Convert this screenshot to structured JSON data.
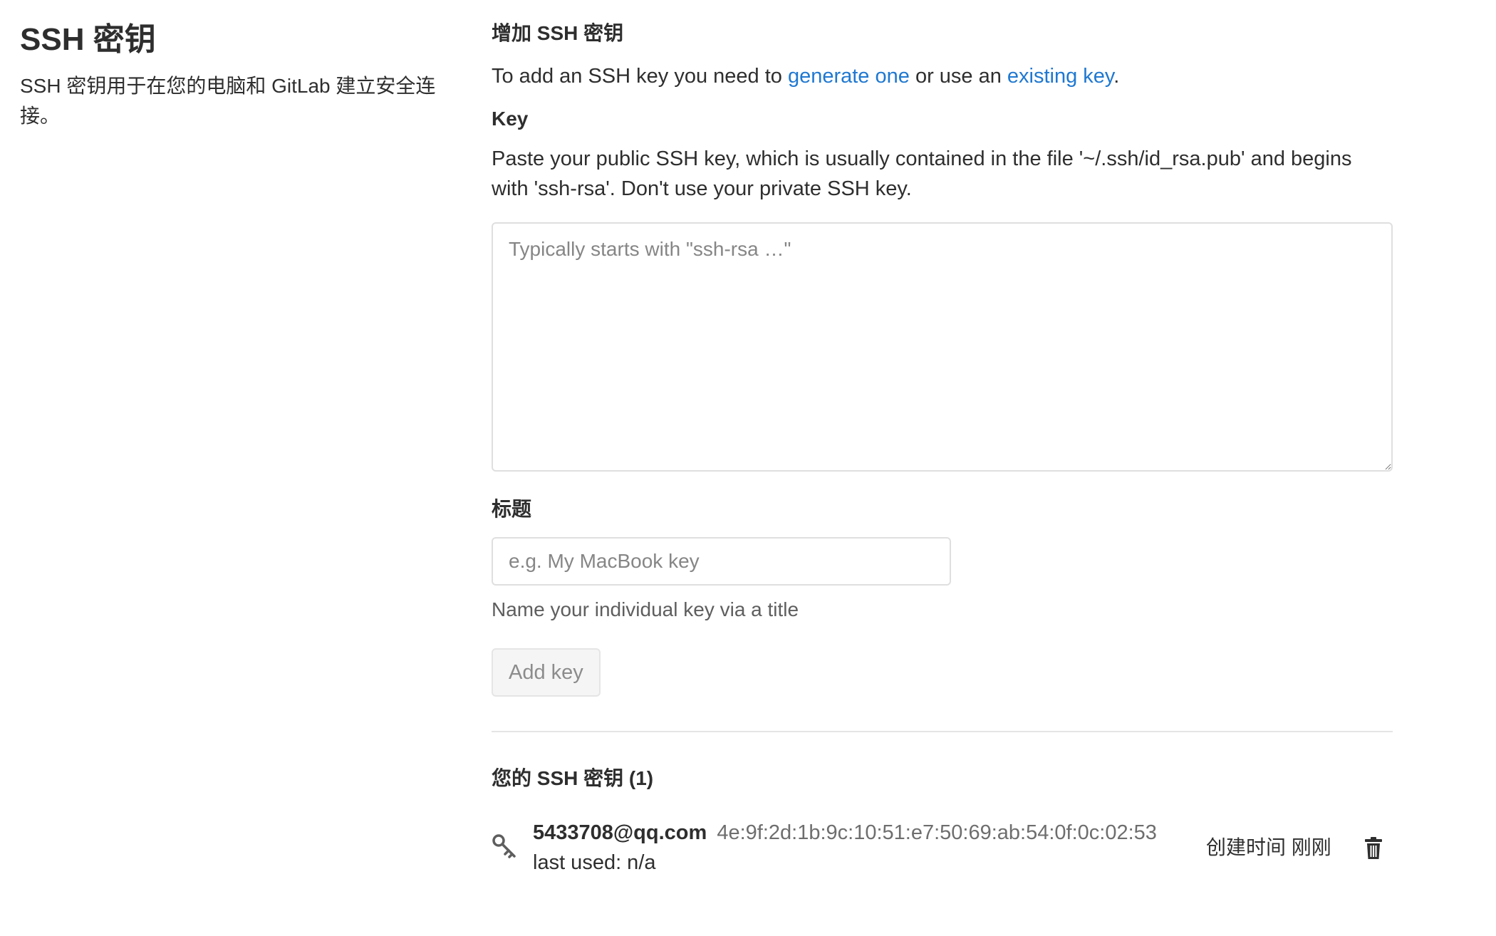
{
  "sidebar": {
    "title": "SSH 密钥",
    "description": "SSH 密钥用于在您的电脑和 GitLab 建立安全连接。"
  },
  "add_section": {
    "heading": "增加 SSH 密钥",
    "intro_prefix": "To add an SSH key you need to ",
    "link_generate": "generate one",
    "intro_middle": " or use an ",
    "link_existing": "existing key",
    "intro_suffix": "."
  },
  "key_field": {
    "label": "Key",
    "help": "Paste your public SSH key, which is usually contained in the file '~/.ssh/id_rsa.pub' and begins with 'ssh-rsa'. Don't use your private SSH key.",
    "placeholder": "Typically starts with \"ssh-rsa …\"",
    "value": ""
  },
  "title_field": {
    "label": "标题",
    "placeholder": "e.g. My MacBook key",
    "value": "",
    "help": "Name your individual key via a title"
  },
  "add_button": {
    "label": "Add key",
    "disabled": true
  },
  "keys_list": {
    "heading": "您的 SSH 密钥 (1)",
    "items": [
      {
        "title": "5433708@qq.com",
        "fingerprint": "4e:9f:2d:1b:9c:10:51:e7:50:69:ab:54:0f:0c:02:53",
        "last_used": "last used: n/a",
        "created": "创建时间 刚刚",
        "icon": "key-icon",
        "delete_icon": "trash-icon"
      }
    ]
  },
  "colors": {
    "link": "#1f78d1",
    "text": "#2e2e2e",
    "muted": "#6e6e6e",
    "border": "#dfdfdf"
  }
}
